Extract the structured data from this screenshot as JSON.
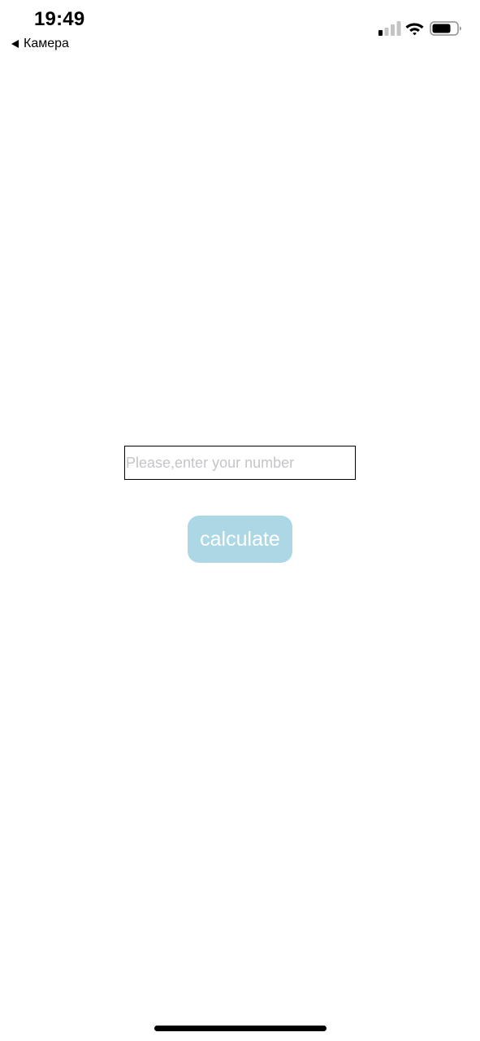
{
  "status_bar": {
    "time": "19:49",
    "back_label": "Камера",
    "icons": [
      "back-triangle-icon",
      "cellular-signal-icon",
      "wifi-icon",
      "battery-icon"
    ]
  },
  "form": {
    "input_value": "",
    "input_placeholder": "Please,enter your number",
    "button_label": "calculate"
  },
  "colors": {
    "button_background": "#acd8e5",
    "button_text": "#ffffff",
    "placeholder_text": "#c5c5c9"
  }
}
